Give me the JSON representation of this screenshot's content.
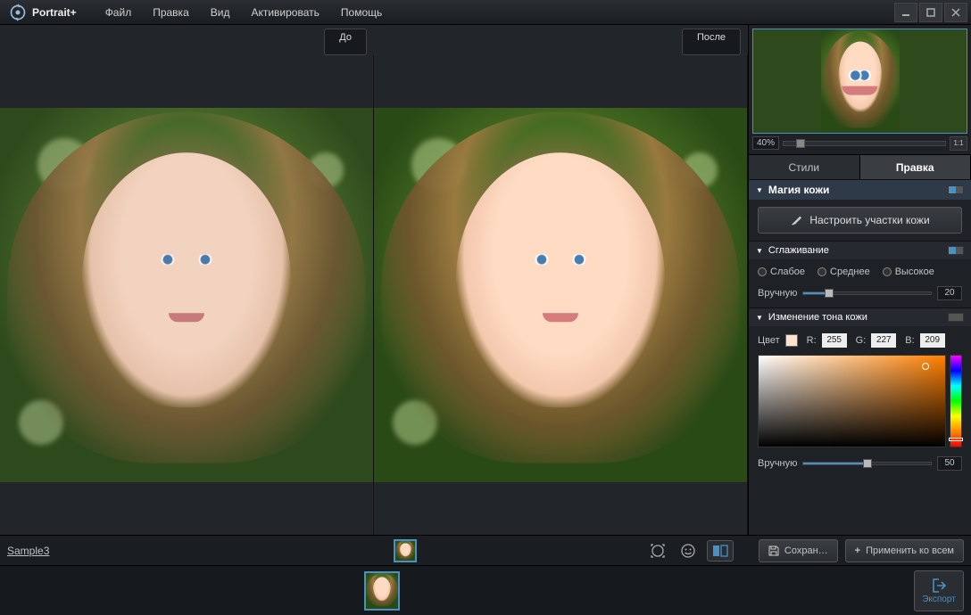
{
  "app": {
    "name": "Portrait+"
  },
  "menu": [
    "Файл",
    "Правка",
    "Вид",
    "Активировать",
    "Помощь"
  ],
  "viewer": {
    "before": "До",
    "after": "После"
  },
  "nav": {
    "zoom_pct": "40%",
    "fit": "1:1"
  },
  "tabs": {
    "styles": "Стили",
    "edit": "Правка",
    "active": "edit"
  },
  "panel": {
    "skin_magic": {
      "title": "Магия кожи",
      "configure_btn": "Настроить участки кожи"
    },
    "smoothing": {
      "title": "Сглаживание",
      "options": [
        "Слабое",
        "Среднее",
        "Высокое"
      ],
      "manual_label": "Вручную",
      "manual_value": "20",
      "manual_pct": 20
    },
    "skin_tone": {
      "title": "Изменение тона кожи",
      "color_label": "Цвет",
      "swatch": "#ffe3d1",
      "r_label": "R:",
      "r_val": "255",
      "g_label": "G:",
      "g_val": "227",
      "b_label": "B:",
      "b_val": "209",
      "manual_label": "Вручную",
      "manual_value": "50",
      "manual_pct": 50
    }
  },
  "toolbar": {
    "project": "Sample3",
    "save": "Сохран…",
    "apply_all": "Применить ко всем"
  },
  "export": {
    "label": "Экспорт"
  }
}
